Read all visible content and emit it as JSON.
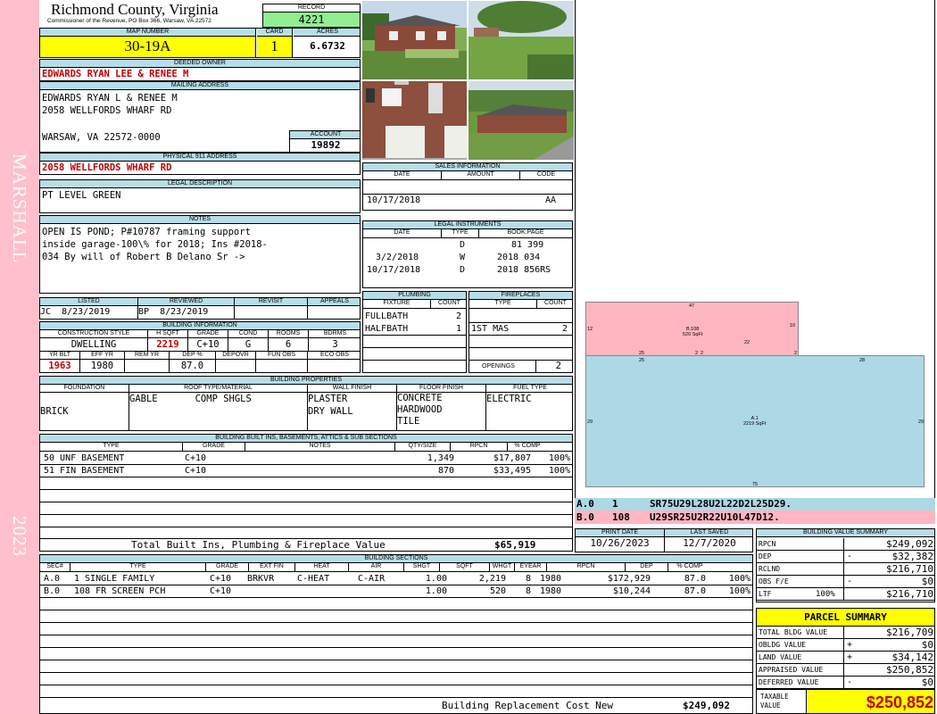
{
  "header": {
    "county": "Richmond County, Virginia",
    "commissioner": "Commissioner of the Revenue, PO Box 366, Warsaw, VA 22572",
    "record_label": "RECORD",
    "record": "4221",
    "map_label": "MAP NUMBER",
    "map_number": "30-19A",
    "card_label": "CARD",
    "card": "1",
    "acres_label": "ACRES",
    "acres": "6.6732"
  },
  "sidebar": {
    "district": "MARSHALL",
    "year": "2023"
  },
  "owner": {
    "deeded_label": "DEEDED OWNER",
    "deeded": "EDWARDS RYAN LEE & RENEE M",
    "mailing_label": "MAILING ADDRESS",
    "mail1": "EDWARDS RYAN L & RENEE M",
    "mail2": "2058 WELLFORDS WHARF RD",
    "mail3": "WARSAW, VA 22572-0000",
    "account_label": "ACCOUNT",
    "account": "19892",
    "physical_label": "PHYSICAL 911 ADDRESS",
    "physical": "2058 WELLFORDS WHARF RD",
    "legal_label": "LEGAL DESCRIPTION",
    "legal": "PT LEVEL GREEN",
    "notes_label": "NOTES",
    "notes1": "OPEN IS POND; P#10787 framing support",
    "notes2": "inside garage-100\\% for 2018; Ins #2018-",
    "notes3": "034 By will of Robert B Delano Sr ->"
  },
  "review": {
    "listed_label": "LISTED",
    "reviewed_label": "REVIEWED",
    "revisit_label": "REVISIT",
    "appeals_label": "APPEALS",
    "listed_by": "JC",
    "listed_date": "8/23/2019",
    "reviewed_by": "BP",
    "reviewed_date": "8/23/2019"
  },
  "building_info": {
    "label": "BUILDING INFORMATION",
    "h_construction": "CONSTRUCTION STYLE",
    "h_hsqft": "H SQFT",
    "h_grade": "GRADE",
    "h_cond": "COND",
    "h_rooms": "ROOMS",
    "h_bdrms": "BDRMS",
    "construction": "DWELLING",
    "hsqft": "2219",
    "grade": "C+10",
    "cond": "G",
    "rooms": "6",
    "bdrms": "3",
    "h_yrblt": "YR BLT",
    "h_effyr": "EFF YR",
    "h_remyr": "REM YR",
    "h_dep": "DEP %",
    "h_depovr": "DEPOVR",
    "h_funobs": "FUN OBS",
    "h_ecoobs": "ECO OBS",
    "yrblt": "1963",
    "effyr": "1980",
    "dep": "87.0"
  },
  "properties": {
    "label": "BUILDING PROPERTIES",
    "h_foundation": "FOUNDATION",
    "h_roof": "ROOF TYPE/MATERIAL",
    "h_wall": "WALL FINISH",
    "h_floor": "FLOOR FINISH",
    "h_fuel": "FUEL TYPE",
    "foundation": "BRICK",
    "roof_type": "GABLE",
    "roof_material": "COMP SHGLS",
    "wall1": "PLASTER",
    "wall2": "DRY WALL",
    "floor1": "CONCRETE",
    "floor2": "HARDWOOD",
    "floor3": "TILE",
    "fuel": "ELECTRIC"
  },
  "builtins": {
    "label": "BUILDING BUILT INS, BASEMENTS, ATTICS & SUB SECTIONS",
    "h_type": "TYPE",
    "h_grade": "GRADE",
    "h_notes": "NOTES",
    "h_qty": "QTY/SIZE",
    "h_rpcn": "RPCN",
    "h_comp": "% COMP",
    "rows": [
      {
        "type": "50 UNF BASEMENT",
        "grade": "C+10",
        "qty": "1,349",
        "rpcn": "$17,807",
        "comp": "100%"
      },
      {
        "type": "51 FIN BASEMENT",
        "grade": "C+10",
        "qty": "870",
        "rpcn": "$33,495",
        "comp": "100%"
      }
    ],
    "total_label": "Total Built Ins, Plumbing & Fireplace Value",
    "total": "$65,919"
  },
  "sections": {
    "label": "BUILDING SECTIONS",
    "h_sec": "SEC#",
    "h_type": "TYPE",
    "h_grade": "GRADE",
    "h_extfin": "EXT FIN",
    "h_heat": "HEAT",
    "h_air": "AIR",
    "h_shgt": "SHGT",
    "h_sqft": "SQFT",
    "h_whgt": "WHGT",
    "h_eyear": "EYEAR",
    "h_rpcn": "RPCN",
    "h_dep": "DEP",
    "h_comp": "% COMP",
    "rows": [
      {
        "sec": "A.0",
        "type": "1 SINGLE FAMILY",
        "grade": "C+10",
        "extfin": "BRKVR",
        "heat": "C-HEAT",
        "air": "C-AIR",
        "shgt": "1.00",
        "sqft": "2,219",
        "whgt": "8",
        "eyear": "1980",
        "rpcn": "$172,929",
        "dep": "87.0",
        "comp": "100%"
      },
      {
        "sec": "B.0",
        "type": "108 FR SCREEN PCH",
        "grade": "C+10",
        "extfin": "",
        "heat": "",
        "air": "",
        "shgt": "1.00",
        "sqft": "520",
        "whgt": "8",
        "eyear": "1980",
        "rpcn": "$10,244",
        "dep": "87.0",
        "comp": "100%"
      }
    ],
    "replacement_label": "Building Replacement Cost New",
    "replacement": "$249,092"
  },
  "sales": {
    "label": "SALES INFORMATION",
    "h_date": "DATE",
    "h_amount": "AMOUNT",
    "h_code": "CODE",
    "date": "10/17/2018",
    "code": "AA"
  },
  "legal_instruments": {
    "label": "LEGAL INSTRUMENTS",
    "h_date": "DATE",
    "h_type": "TYPE",
    "h_book": "BOOK:PAGE",
    "rows": [
      {
        "date": "",
        "type": "D",
        "book": "81 399"
      },
      {
        "date": "3/2/2018",
        "type": "W",
        "book": "2018 034"
      },
      {
        "date": "10/17/2018",
        "type": "D",
        "book": "2018 856RS"
      }
    ]
  },
  "plumbing": {
    "label": "PLUMBING",
    "h_fixture": "FIXTURE",
    "h_count": "COUNT",
    "rows": [
      {
        "fixture": "FULLBATH",
        "count": "2"
      },
      {
        "fixture": "HALFBATH",
        "count": "1"
      }
    ]
  },
  "fireplaces": {
    "label": "FIREPLACES",
    "h_type": "TYPE",
    "h_count": "COUNT",
    "type": "1ST MAS",
    "count": "2",
    "openings_label": "OPENINGS",
    "openings": "2"
  },
  "sketch": {
    "b_label": "B.108",
    "b_area": "520 SqFt",
    "a_label": "A.1",
    "a_area": "2219 SqFt",
    "dims": {
      "top": "47",
      "left_b": "12",
      "right_b": "10",
      "mid": "22",
      "d25a": "25",
      "d2a": "2",
      "d2b": "2",
      "d2c": "2",
      "d25b": "25",
      "d28": "28",
      "d29l": "29",
      "d29r": "29",
      "d75": "75"
    },
    "codes": [
      {
        "sec": "A.0",
        "num": "1",
        "code": "SR75U29L28U2L22D2L25D29."
      },
      {
        "sec": "B.0",
        "num": "108",
        "code": "U29SR25U2R22U10L47D12."
      }
    ]
  },
  "dates": {
    "print_label": "PRINT DATE",
    "print": "10/26/2023",
    "saved_label": "LAST SAVED",
    "saved": "12/7/2020"
  },
  "value_summary": {
    "label": "BUILDING VALUE SUMMARY",
    "rows": [
      {
        "label": "RPCN",
        "sign": "",
        "value": "$249,092"
      },
      {
        "label": "DEP",
        "sign": "-",
        "value": "$32,382"
      },
      {
        "label": "RCLND",
        "sign": "",
        "value": "$216,710"
      },
      {
        "label": "OBS F/E",
        "sign": "-",
        "value": "$0"
      },
      {
        "label": "LTF",
        "sign": "100%",
        "value": "$216,710"
      }
    ]
  },
  "parcel_summary": {
    "label": "PARCEL SUMMARY",
    "rows": [
      {
        "label": "TOTAL BLDG VALUE",
        "sign": "",
        "value": "$216,709"
      },
      {
        "label": "OBLDG VALUE",
        "sign": "+",
        "value": "$0"
      },
      {
        "label": "LAND VALUE",
        "sign": "+",
        "value": "$34,142"
      },
      {
        "label": "APPRAISED VALUE",
        "sign": "",
        "value": "$250,852"
      },
      {
        "label": "DEFERRED VALUE",
        "sign": "-",
        "value": "$0"
      }
    ],
    "taxable_label1": "TAXABLE",
    "taxable_label2": "VALUE",
    "taxable": "$250,852"
  },
  "colors": {
    "sidebar": "#ffc0cb",
    "header": "#b7dde8",
    "record": "#90ee90",
    "yellow": "#ffff00",
    "sketch_a": "#add8e6",
    "sketch_b": "#ffb6c1",
    "red": "#c00000"
  }
}
